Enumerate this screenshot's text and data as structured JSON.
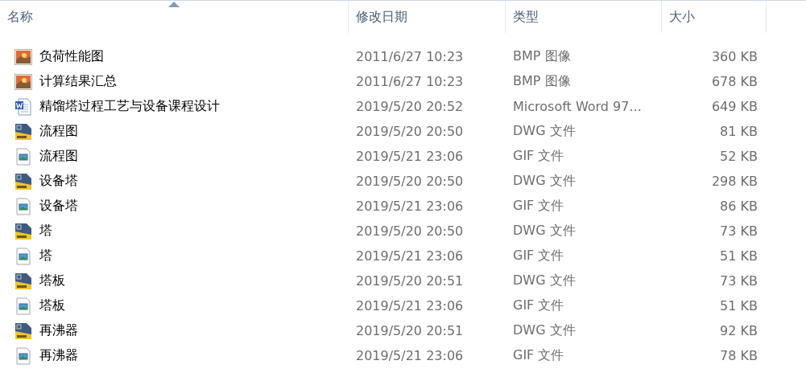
{
  "columns": [
    {
      "label": "名称",
      "sorted": true
    },
    {
      "label": "修改日期",
      "sorted": false
    },
    {
      "label": "类型",
      "sorted": false
    },
    {
      "label": "大小",
      "sorted": false
    }
  ],
  "rows": [
    {
      "kind": "bmp",
      "name": "负荷性能图",
      "date": "2011/6/27 10:23",
      "type": "BMP 图像",
      "size": "360 KB"
    },
    {
      "kind": "bmp",
      "name": "计算结果汇总",
      "date": "2011/6/27 10:23",
      "type": "BMP 图像",
      "size": "678 KB"
    },
    {
      "kind": "word",
      "name": "精馏塔过程工艺与设备课程设计",
      "date": "2019/5/20 20:52",
      "type": "Microsoft Word 97...",
      "size": "649 KB"
    },
    {
      "kind": "dwg",
      "name": "流程图",
      "date": "2019/5/20 20:50",
      "type": "DWG 文件",
      "size": "81 KB"
    },
    {
      "kind": "gif",
      "name": "流程图",
      "date": "2019/5/21 23:06",
      "type": "GIF 文件",
      "size": "52 KB"
    },
    {
      "kind": "dwg",
      "name": "设备塔",
      "date": "2019/5/20 20:50",
      "type": "DWG 文件",
      "size": "298 KB"
    },
    {
      "kind": "gif",
      "name": "设备塔",
      "date": "2019/5/21 23:06",
      "type": "GIF 文件",
      "size": "86 KB"
    },
    {
      "kind": "dwg",
      "name": "塔",
      "date": "2019/5/20 20:50",
      "type": "DWG 文件",
      "size": "73 KB"
    },
    {
      "kind": "gif",
      "name": "塔",
      "date": "2019/5/21 23:06",
      "type": "GIF 文件",
      "size": "51 KB"
    },
    {
      "kind": "dwg",
      "name": "塔板",
      "date": "2019/5/20 20:51",
      "type": "DWG 文件",
      "size": "73 KB"
    },
    {
      "kind": "gif",
      "name": "塔板",
      "date": "2019/5/21 23:06",
      "type": "GIF 文件",
      "size": "51 KB"
    },
    {
      "kind": "dwg",
      "name": "再沸器",
      "date": "2019/5/20 20:51",
      "type": "DWG 文件",
      "size": "92 KB"
    },
    {
      "kind": "gif",
      "name": "再沸器",
      "date": "2019/5/21 23:06",
      "type": "GIF 文件",
      "size": "78 KB"
    }
  ]
}
